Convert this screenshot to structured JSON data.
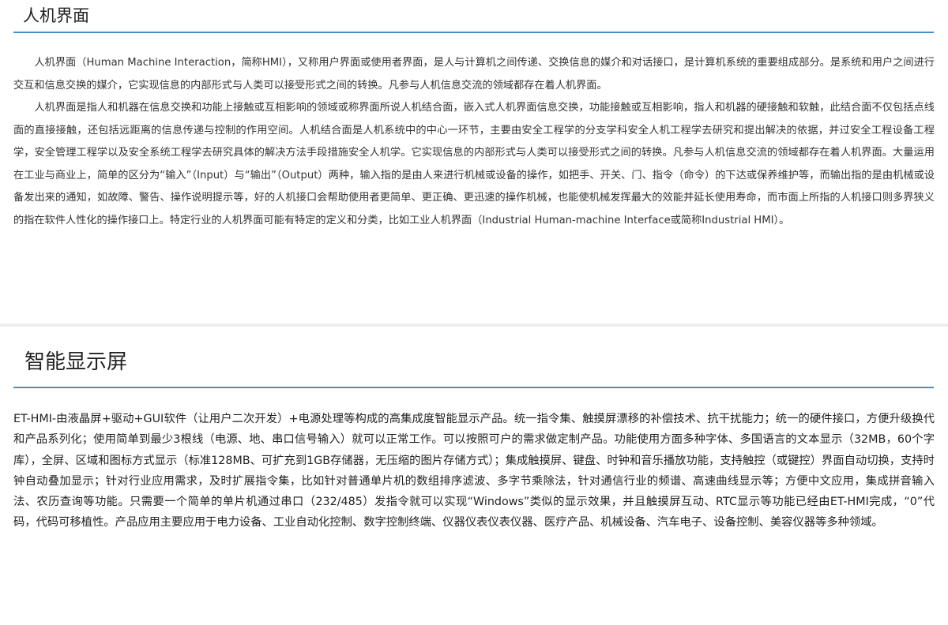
{
  "section1": {
    "title": "人机界面",
    "paragraphs": [
      "人机界面（Human Machine Interaction，简称HMI），又称用户界面或使用者界面，是人与计算机之间传递、交换信息的媒介和对话接口，是计算机系统的重要组成部分。是系统和用户之间进行交互和信息交换的媒介，它实现信息的内部形式与人类可以接受形式之间的转换。凡参与人机信息交流的领域都存在着人机界面。",
      "人机界面是指人和机器在信息交换和功能上接触或互相影响的领域或称界面所说人机结合面，嵌入式人机界面信息交换，功能接触或互相影响，指人和机器的硬接触和软触，此结合面不仅包括点线面的直接接触，还包括远距离的信息传递与控制的作用空间。人机结合面是人机系统中的中心一环节，主要由安全工程学的分支学科安全人机工程学去研究和提出解决的依据，并过安全工程设备工程学，安全管理工程学以及安全系统工程学去研究具体的解决方法手段措施安全人机学。它实现信息的内部形式与人类可以接受形式之间的转换。凡参与人机信息交流的领域都存在着人机界面。大量运用在工业与商业上，简单的区分为“输入”（Input）与“输出”（Output）两种，输入指的是由人来进行机械或设备的操作，如把手、开关、门、指令（命令）的下达或保养维护等，而输出指的是由机械或设备发出来的通知，如故障、警告、操作说明提示等，好的人机接口会帮助使用者更简单、更正确、更迅速的操作机械，也能使机械发挥最大的效能并延长使用寿命，而市面上所指的人机接口则多界狭义的指在软件人性化的操作接口上。特定行业的人机界面可能有特定的定义和分类，比如工业人机界面（Industrial Human-machine Interface或简称Industrial HMI）。"
    ]
  },
  "section2": {
    "title": "智能显示屏",
    "paragraph": "ET-HMI-由液晶屏+驱动+GUI软件（让用户二次开发）+电源处理等构成的高集成度智能显示产品。统一指令集、触摸屏漂移的补偿技术、抗干扰能力；统一的硬件接口，方便升级换代和产品系列化；使用简单到最少3根线（电源、地、串口信号输入）就可以正常工作。可以按照可户的需求做定制产品。功能使用方面多种字体、多国语言的文本显示（32MB，60个字库），全屏、区域和图标方式显示（标准128MB、可扩充到1GB存储器，无压缩的图片存储方式）；集成触摸屏、键盘、时钟和音乐播放功能，支持触控（或键控）界面自动切换，支持时钟自动叠加显示；针对行业应用需求，及时扩展指令集，比如针对普通单片机的数组排序滤波、多字节乘除法，针对通信行业的频谱、高速曲线显示等；方便中文应用，集成拼音输入法、农历查询等功能。只需要一个简单的单片机通过串口（232/485）发指令就可以实现“Windows”类似的显示效果，并且触摸屏互动、RTC显示等功能已经由ET-HMI完成，“0”代码，代码可移植性。产品应用主要应用于电力设备、工业自动化控制、数字控制终端、仪器仪表仪表仪器、医疗产品、机械设备、汽车电子、设备控制、美容仪器等多种领域。"
  }
}
